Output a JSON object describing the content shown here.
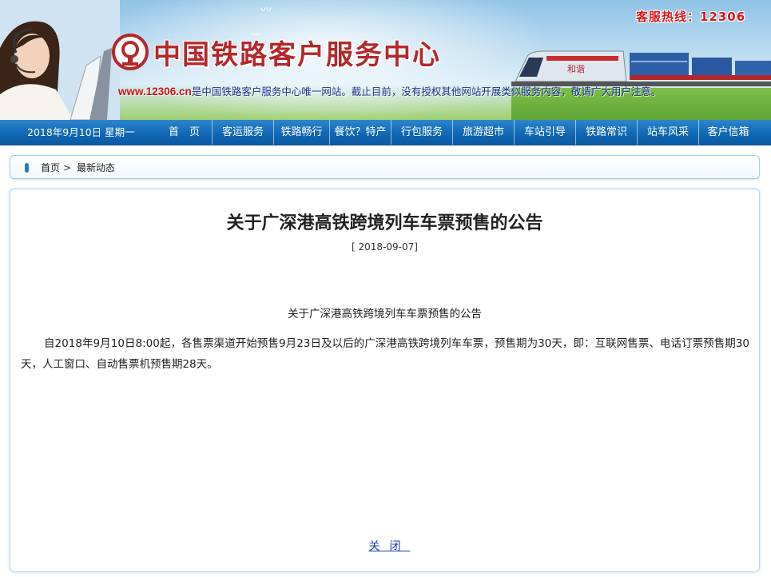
{
  "banner": {
    "site_title": "中国铁路客户服务中心",
    "hotline": "客服热线：12306",
    "notice_url": "www.12306.cn",
    "notice_text": "是中国铁路客户服务中心唯一网站。截止目前，没有授权其他网站开展类似服务内容，敬请广大用户注意。",
    "train_label": "和谐",
    "icons": [
      "rail-logo",
      "customer-service-woman",
      "bird",
      "freight-train"
    ]
  },
  "nav": {
    "date": "2018年9月10日 星期一",
    "items": [
      {
        "label": "首　页"
      },
      {
        "label": "客运服务"
      },
      {
        "label": "铁路畅行"
      },
      {
        "label": "餐饮？特产"
      },
      {
        "label": "行包服务"
      },
      {
        "label": "旅游超市"
      },
      {
        "label": "车站引导"
      },
      {
        "label": "铁路常识"
      },
      {
        "label": "站车风采"
      },
      {
        "label": "客户信箱"
      }
    ]
  },
  "breadcrumb": {
    "home": "首页",
    "separator": ">",
    "current": "最新动态"
  },
  "article": {
    "title": "关于广深港高铁跨境列车车票预售的公告",
    "date": "2018-09-07",
    "subtitle": "关于广深港高铁跨境列车车票预售的公告",
    "body": "自2018年9月10日8:00起，各售票渠道开始预售9月23日及以后的广深港高铁跨境列车车票，预售期为30天，即：互联网售票、电话订票预售期30天，人工窗口、自动售票机预售期28天。",
    "close_label": "关闭"
  },
  "colors": {
    "nav_blue": "#1168b4",
    "brand_red": "#b5282a",
    "link_blue": "#1a3fa8"
  }
}
